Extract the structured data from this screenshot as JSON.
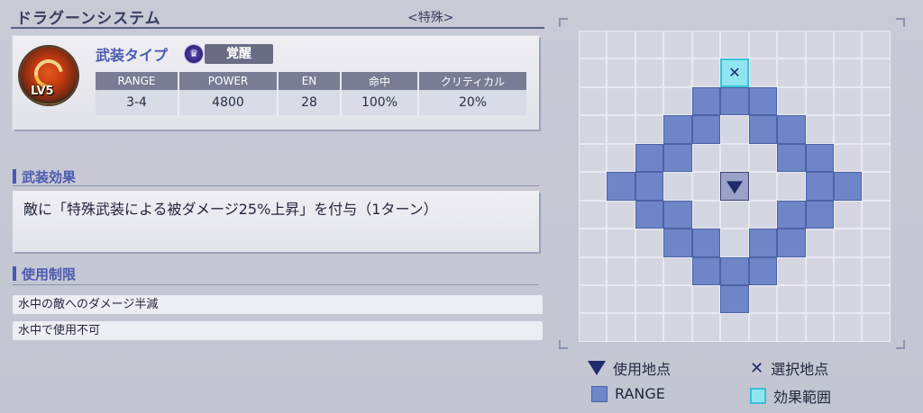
{
  "header": {
    "title": "ドラグーンシステム",
    "category": "<特殊>"
  },
  "weapon": {
    "level": "LV5",
    "type_label": "武装タイプ",
    "awaken_icon": "crown-icon",
    "awaken_label": "覚醒",
    "stats_headers": [
      "RANGE",
      "POWER",
      "EN",
      "命中",
      "クリティカル"
    ],
    "stats_values": [
      "3-4",
      "4800",
      "28",
      "100%",
      "20%"
    ]
  },
  "effect_section": {
    "heading": "武装効果",
    "text": "敵に「特殊武装による被ダメージ25%上昇」を付与（1ターン）"
  },
  "limit_section": {
    "heading": "使用制限",
    "items": [
      "水中の敵へのダメージ半減",
      "水中で使用不可"
    ]
  },
  "range_grid": {
    "size": 11,
    "origin": [
      5,
      5
    ],
    "effect_cells": [
      [
        5,
        1
      ]
    ],
    "range_cells": [
      [
        4,
        2
      ],
      [
        5,
        2
      ],
      [
        6,
        2
      ],
      [
        3,
        3
      ],
      [
        4,
        3
      ],
      [
        6,
        3
      ],
      [
        7,
        3
      ],
      [
        2,
        4
      ],
      [
        3,
        4
      ],
      [
        7,
        4
      ],
      [
        8,
        4
      ],
      [
        1,
        5
      ],
      [
        2,
        5
      ],
      [
        8,
        5
      ],
      [
        9,
        5
      ],
      [
        2,
        6
      ],
      [
        3,
        6
      ],
      [
        7,
        6
      ],
      [
        8,
        6
      ],
      [
        3,
        7
      ],
      [
        4,
        7
      ],
      [
        6,
        7
      ],
      [
        7,
        7
      ],
      [
        4,
        8
      ],
      [
        5,
        8
      ],
      [
        6,
        8
      ],
      [
        5,
        9
      ]
    ],
    "colors": {
      "range": "#6e86c8",
      "effect": "#8fe6f0",
      "empty": "#d4d6e2"
    }
  },
  "legend": {
    "use_point": "使用地点",
    "select_point": "選択地点",
    "range": "RANGE",
    "effect_area": "効果範囲"
  }
}
